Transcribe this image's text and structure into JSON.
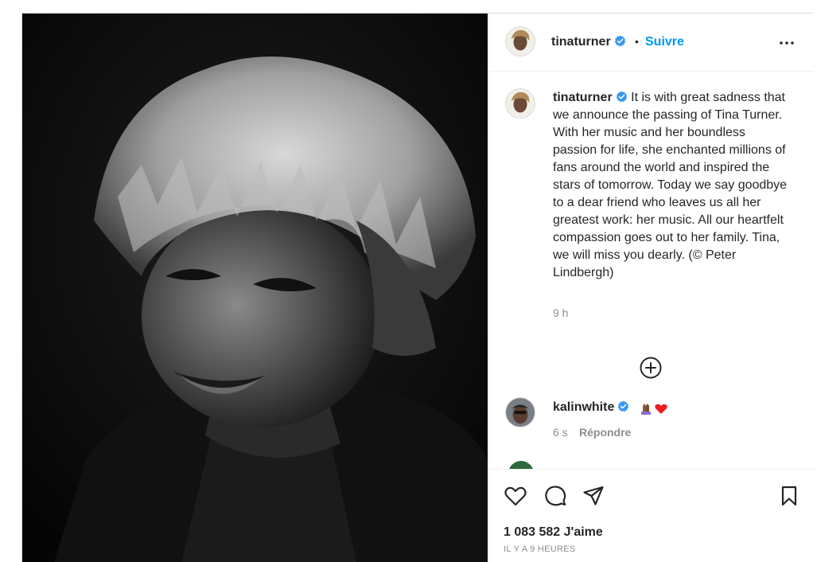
{
  "header": {
    "username": "tinaturner",
    "separator": "•",
    "follow_label": "Suivre",
    "more_icon": "more-dots-icon"
  },
  "caption": {
    "username": "tinaturner",
    "text": "It is with great sadness that we announce the passing of Tina Turner. With her music and her boundless passion for life, she enchanted millions of fans around the world and inspired the stars of tomorrow. Today we say goodbye to a dear friend who leaves us all her greatest work: her music. All our heartfelt compassion goes out to her family. Tina, we will miss you dearly. (© Peter Lindbergh)",
    "time": "9 h"
  },
  "load_more_icon": "plus-circle-icon",
  "comments": [
    {
      "username": "kalinwhite",
      "emoji": "🙏🏾❤️",
      "time": "6 s",
      "reply_label": "Répondre"
    }
  ],
  "actions": {
    "like_icon": "heart-icon",
    "comment_icon": "comment-icon",
    "share_icon": "send-icon",
    "save_icon": "bookmark-icon"
  },
  "likes": "1 083 582 J'aime",
  "posted": "IL Y A 9 HEURES",
  "colors": {
    "link": "#0095f6",
    "verified": "#3897f0",
    "muted": "#8e8e8e",
    "text": "#262626"
  }
}
